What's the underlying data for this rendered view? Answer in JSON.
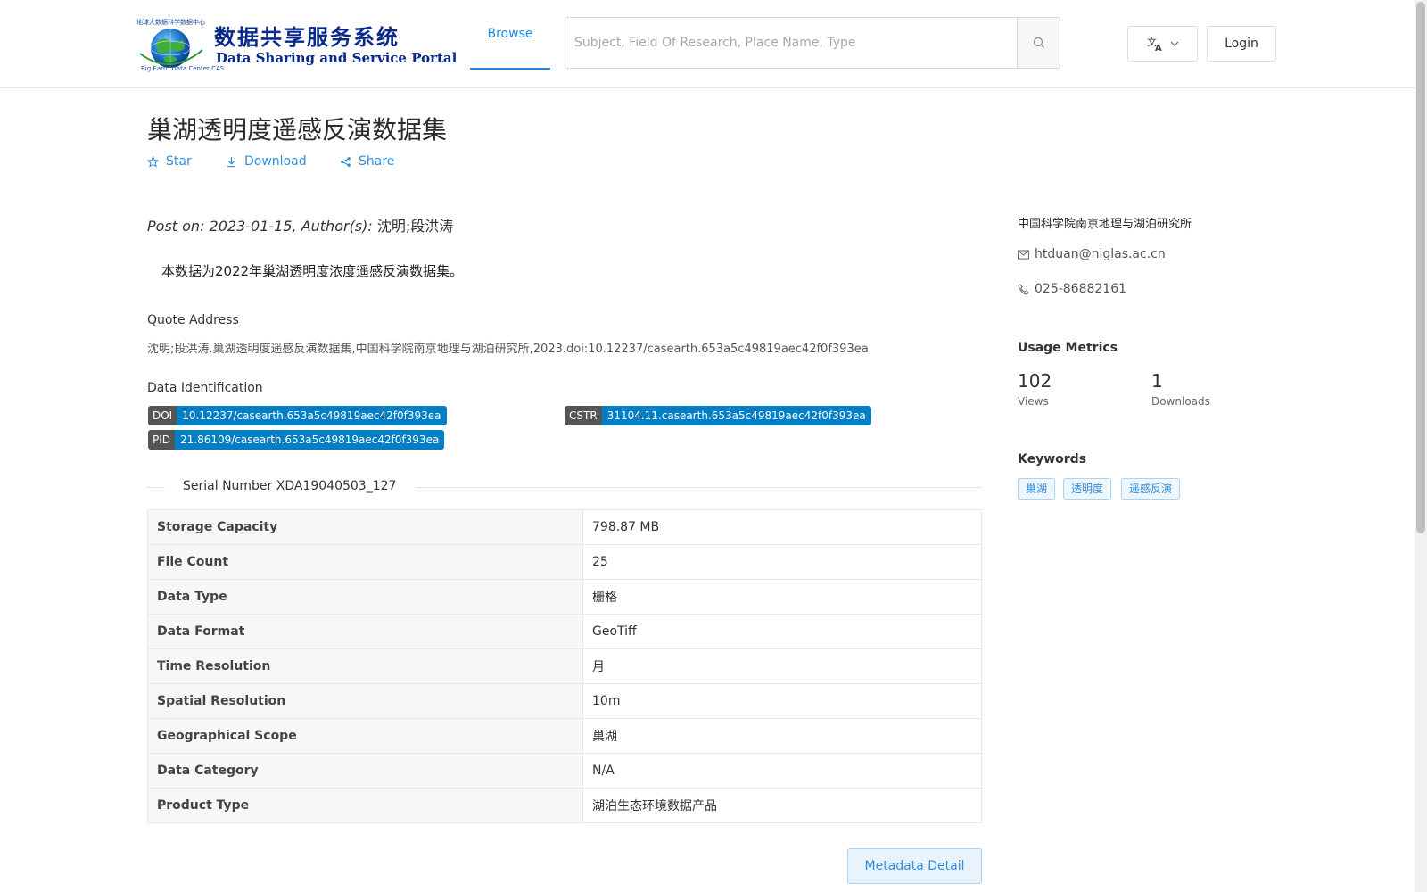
{
  "header": {
    "logo_cn": "数据共享服务系统",
    "logo_en": "Data Sharing and Service Portal",
    "logo_arc": "地球大数据科学数据中心",
    "logo_small": "Big Earth Data Center,CAS",
    "nav_browse": "Browse",
    "search_placeholder": "Subject, Field Of Research, Place Name, Type",
    "search_value": "",
    "login_label": "Login"
  },
  "page": {
    "title": "巢湖透明度遥感反演数据集",
    "actions": {
      "star": "Star",
      "download": "Download",
      "share": "Share"
    },
    "post_on_label": "Post on: 2023-01-15, Author(s): ",
    "authors": "沈明;段洪涛",
    "description": "本数据为2022年巢湖透明度浓度遥感反演数据集。",
    "quote_heading": "Quote Address",
    "quote_text": "沈明;段洪涛.巢湖透明度遥感反演数据集,中国科学院南京地理与湖泊研究所,2023.doi:10.12237/casearth.653a5c49819aec42f0f393ea",
    "ident_heading": "Data Identification",
    "identifiers": {
      "doi": {
        "key": "DOI",
        "value": "10.12237/casearth.653a5c49819aec42f0f393ea"
      },
      "cstr": {
        "key": "CSTR",
        "value": "31104.11.casearth.653a5c49819aec42f0f393ea"
      },
      "pid": {
        "key": "PID",
        "value": "21.86109/casearth.653a5c49819aec42f0f393ea"
      }
    },
    "serial_number": "Serial Number XDA19040503_127",
    "attributes": [
      {
        "key": "Storage Capacity",
        "value": "798.87 MB"
      },
      {
        "key": "File Count",
        "value": "25"
      },
      {
        "key": "Data Type",
        "value": "栅格"
      },
      {
        "key": "Data Format",
        "value": "GeoTiff"
      },
      {
        "key": "Time Resolution",
        "value": "月"
      },
      {
        "key": "Spatial Resolution",
        "value": "10m"
      },
      {
        "key": "Geographical Scope",
        "value": "巢湖"
      },
      {
        "key": "Data Category",
        "value": "N/A"
      },
      {
        "key": "Product Type",
        "value": "湖泊生态环境数据产品"
      }
    ],
    "metadata_detail_label": "Metadata Detail"
  },
  "sidebar": {
    "organization": "中国科学院南京地理与湖泊研究所",
    "email": "htduan@niglas.ac.cn",
    "phone": "025-86882161",
    "metrics_heading": "Usage Metrics",
    "views_count": "102",
    "views_label": "Views",
    "downloads_count": "1",
    "downloads_label": "Downloads",
    "keywords_heading": "Keywords",
    "keywords": [
      "巢湖",
      "透明度",
      "遥感反演"
    ]
  },
  "icons": {
    "star": "star-icon",
    "download": "download-icon",
    "share": "share-icon",
    "search": "search-icon",
    "language": "translate-icon",
    "chevron": "chevron-down-icon",
    "mail": "mail-icon",
    "phone": "phone-icon"
  },
  "colors": {
    "accent": "#1f88e5",
    "badge_key": "#555555",
    "badge_value": "#007ec6",
    "logo_text": "#0a2a8a"
  }
}
